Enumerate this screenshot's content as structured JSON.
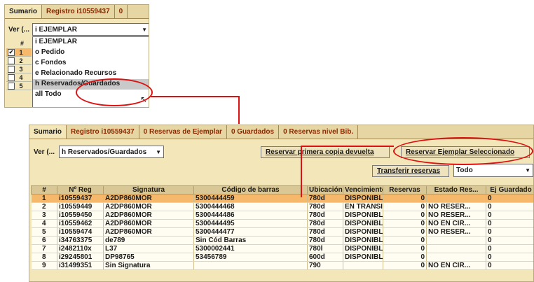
{
  "top": {
    "tabs": [
      "Sumario",
      "Registro i10559437",
      "0"
    ],
    "ver_label": "Ver (...",
    "select_value": "i EJEMPLAR",
    "options": [
      "i EJEMPLAR",
      "o Pedido",
      "c Fondos",
      "e Relacionado Recursos",
      "h Reservados/Guardados",
      "all Todo"
    ],
    "rows": [
      {
        "checked": "✔",
        "n": "1"
      },
      {
        "checked": "",
        "n": "2"
      },
      {
        "checked": "",
        "n": "3"
      },
      {
        "checked": "",
        "n": "4"
      },
      {
        "checked": "",
        "n": "5"
      }
    ],
    "hash": "#"
  },
  "main": {
    "tabs": [
      "Sumario",
      "Registro i10559437",
      "0 Reservas de Ejemplar",
      "0 Guardados",
      "0 Reservas nivel Bib."
    ],
    "ver_label": "Ver (...",
    "select_value": "h Reservados/Guardados",
    "btn_reserve_first": "Reservar primera copia devuelta",
    "btn_reserve_selected": "Reservar Ejemplar Seleccionado",
    "btn_transfer": "Transferir reservas",
    "filter_value": "Todo",
    "columns": [
      "#",
      "Nº Reg",
      "Signatura",
      "Código de barras",
      "Ubicación",
      "Vencimiento",
      "Reservas",
      "Estado Res...",
      "Ej Guardado"
    ],
    "rows": [
      [
        "1",
        "i10559437",
        "A2DP860MOR",
        "5300444459",
        "780d",
        "DISPONIBLE",
        "0",
        "",
        "0"
      ],
      [
        "2",
        "i10559449",
        "A2DP860MOR",
        "5300444468",
        "780d",
        "EN TRANSI...",
        "0",
        "NO RESER...",
        "0"
      ],
      [
        "3",
        "i10559450",
        "A2DP860MOR",
        "5300444486",
        "780d",
        "DISPONIBLE",
        "0",
        "NO RESER...",
        "0"
      ],
      [
        "4",
        "i10559462",
        "A2DP860MOR",
        "5300444495",
        "780d",
        "DISPONIBLE",
        "0",
        "NO EN CIR...",
        "0"
      ],
      [
        "5",
        "i10559474",
        "A2DP860MOR",
        "5300444477",
        "780d",
        "DISPONIBLE",
        "0",
        "NO RESER...",
        "0"
      ],
      [
        "6",
        "i34763375",
        "de789",
        "Sin Cód Barras",
        "780d",
        "DISPONIBLE",
        "0",
        "",
        "0"
      ],
      [
        "7",
        "i2482110x",
        "L37",
        "5300002441",
        "780l",
        "DISPONIBLE",
        "0",
        "",
        "0"
      ],
      [
        "8",
        "i29245801",
        "DP98765",
        "53456789",
        "600d",
        "DISPONIBLE",
        "0",
        "",
        "0"
      ],
      [
        "9",
        "i31499351",
        "Sin Signatura",
        "",
        "790",
        "",
        "0",
        "NO EN CIR...",
        "0"
      ]
    ]
  }
}
